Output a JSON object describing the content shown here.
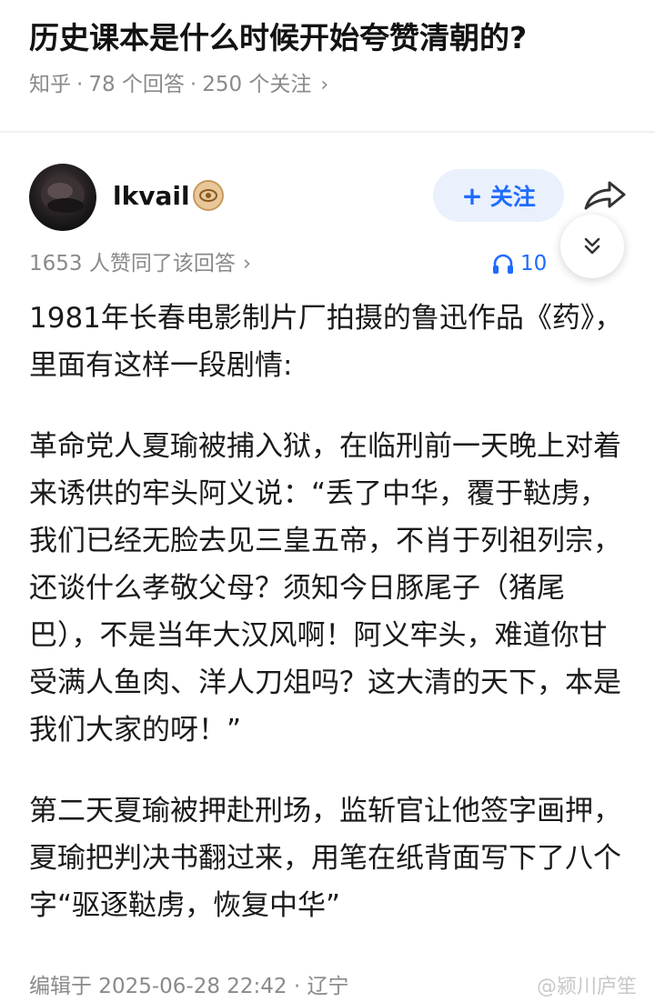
{
  "question": {
    "title": "历史课本是什么时候开始夸赞清朝的?",
    "source": "知乎",
    "answers": "78 个回答",
    "follows": "250 个关注",
    "chevron": "›"
  },
  "author": {
    "name": "lkvail",
    "follow_label": "关注",
    "follow_plus": "+"
  },
  "stats": {
    "votes": "1653 人赞同了该回答",
    "chevron": "›",
    "listen": "10"
  },
  "content": {
    "p1": "1981年长春电影制片厂拍摄的鲁迅作品《药》，里面有这样一段剧情:",
    "p2": "革命党人夏瑜被捕入狱，在临刑前一天晚上对着来诱供的牢头阿义说：“丢了中华，覆于鞑虏，我们已经无脸去见三皇五帝，不肖于列祖列宗，还谈什么孝敬父母？须知今日豚尾子（猪尾巴），不是当年大汉风啊！阿义牢头，难道你甘受满人鱼肉、洋人刀俎吗？这大清的天下，本是我们大家的呀！”",
    "p3": "第二天夏瑜被押赴刑场，监斩官让他签字画押，夏瑜把判决书翻过来，用笔在纸背面写下了八个字“驱逐鞑虏，恢复中华”"
  },
  "footer": {
    "edit_info": "编辑于 2025-06-28 22:42 · 辽宁",
    "watermark": "@颍川庐笙"
  },
  "icons": {
    "share": "share-icon",
    "headphones": "headphones-icon",
    "expand": "double-chevron-down-icon",
    "badge": "eye-badge-icon"
  },
  "colors": {
    "accent": "#1f6bff",
    "follow_bg": "#eaf1fd",
    "meta_text": "#8a8a8a"
  }
}
